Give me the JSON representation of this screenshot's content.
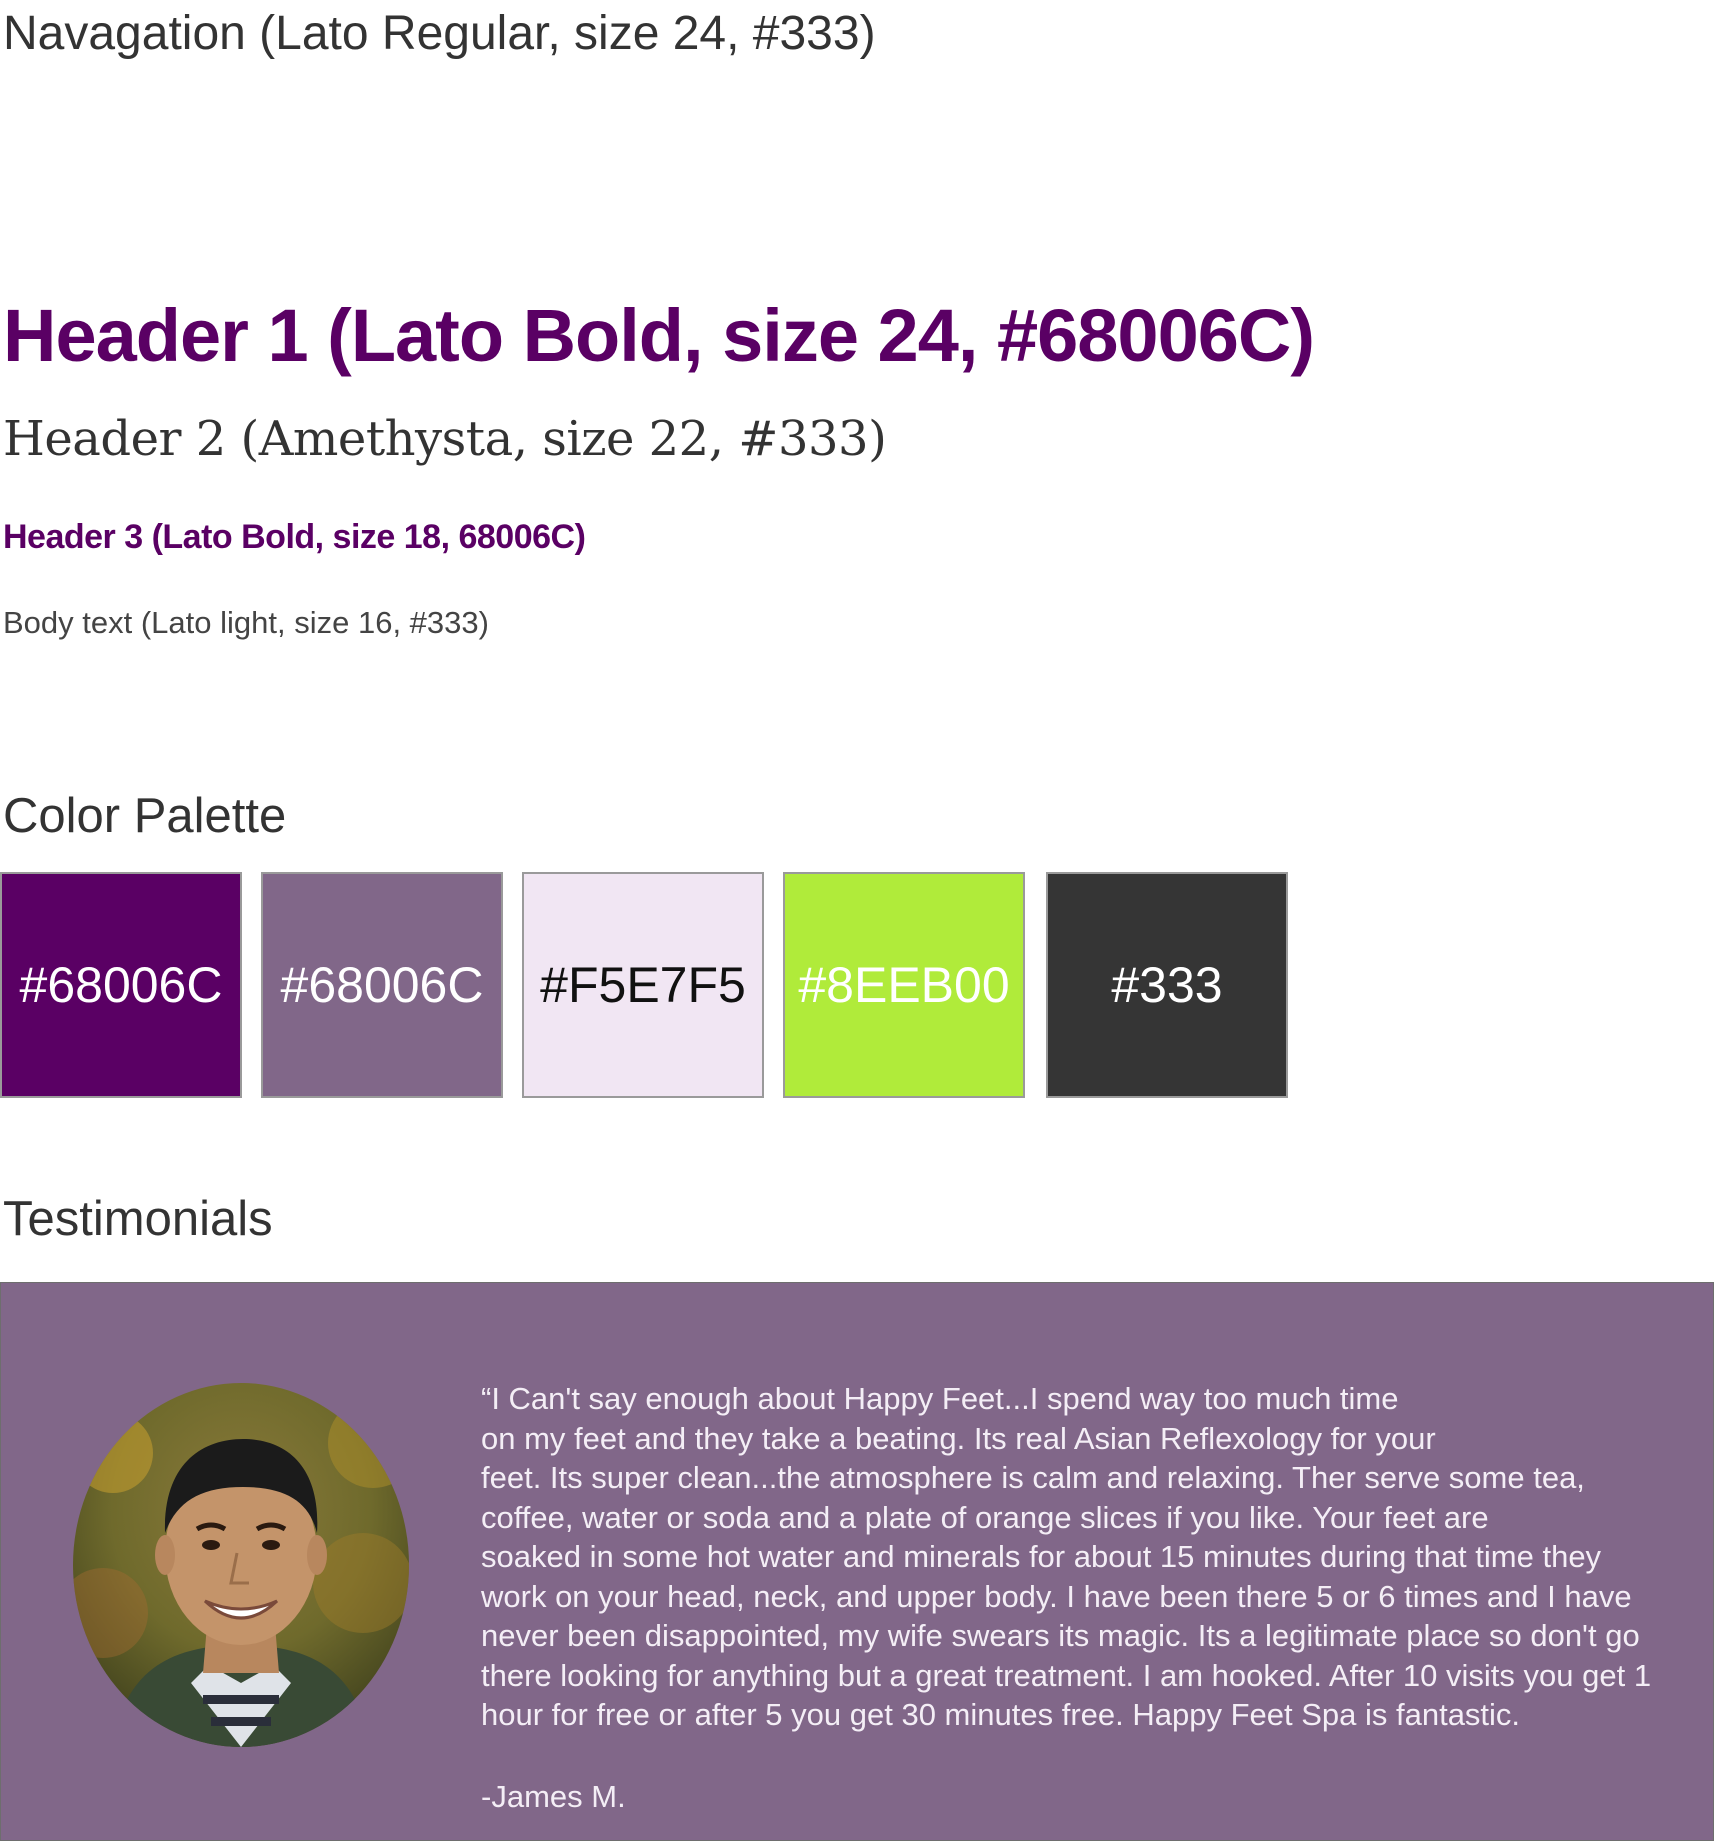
{
  "typography": {
    "navigation": "Navagation (Lato Regular, size 24, #333)",
    "header1": "Header 1 (Lato Bold, size 24, #68006C)",
    "header2": "Header 2 (Amethysta, size 22, #333)",
    "header3": "Header 3 (Lato Bold, size 18, 68006C)",
    "body": "Body text (Lato light, size 16, #333)"
  },
  "palette": {
    "title": "Color Palette",
    "swatches": [
      {
        "label": "#68006C",
        "color": "#5a0064",
        "text_color": "#ffffff"
      },
      {
        "label": "#68006C",
        "color": "#816789",
        "text_color": "#ffffff"
      },
      {
        "label": "#F5E7F5",
        "color": "#f1e6f3",
        "text_color": "#111111"
      },
      {
        "label": "#8EEB00",
        "color": "#b0eb3a",
        "text_color": "#ffffff"
      },
      {
        "label": "#333",
        "color": "#353535",
        "text_color": "#ffffff"
      }
    ]
  },
  "testimonials": {
    "title": "Testimonials",
    "background": "#816789",
    "avatar_icon": "person-photo-icon",
    "quote_lines": [
      "“I Can't say enough about Happy Feet...I spend way too much time",
      "on my feet and they take a beating. Its real Asian Reflexology for your",
      "feet. Its super clean...the atmosphere is calm and relaxing. Ther serve some tea,",
      "coffee, water or soda and a plate of orange slices if you like. Your feet are",
      "soaked in some hot water and minerals for about 15 minutes during that time they",
      "work on your head, neck, and upper body. I have been there 5 or 6 times and I have",
      "never been disappointed, my wife swears its magic. Its a legitimate place so don't go",
      "there looking for anything but a great treatment. I am hooked. After 10 visits you get 1",
      "hour for free or after 5 you get 30 minutes free. Happy Feet Spa is fantastic."
    ],
    "author": "-James M."
  }
}
